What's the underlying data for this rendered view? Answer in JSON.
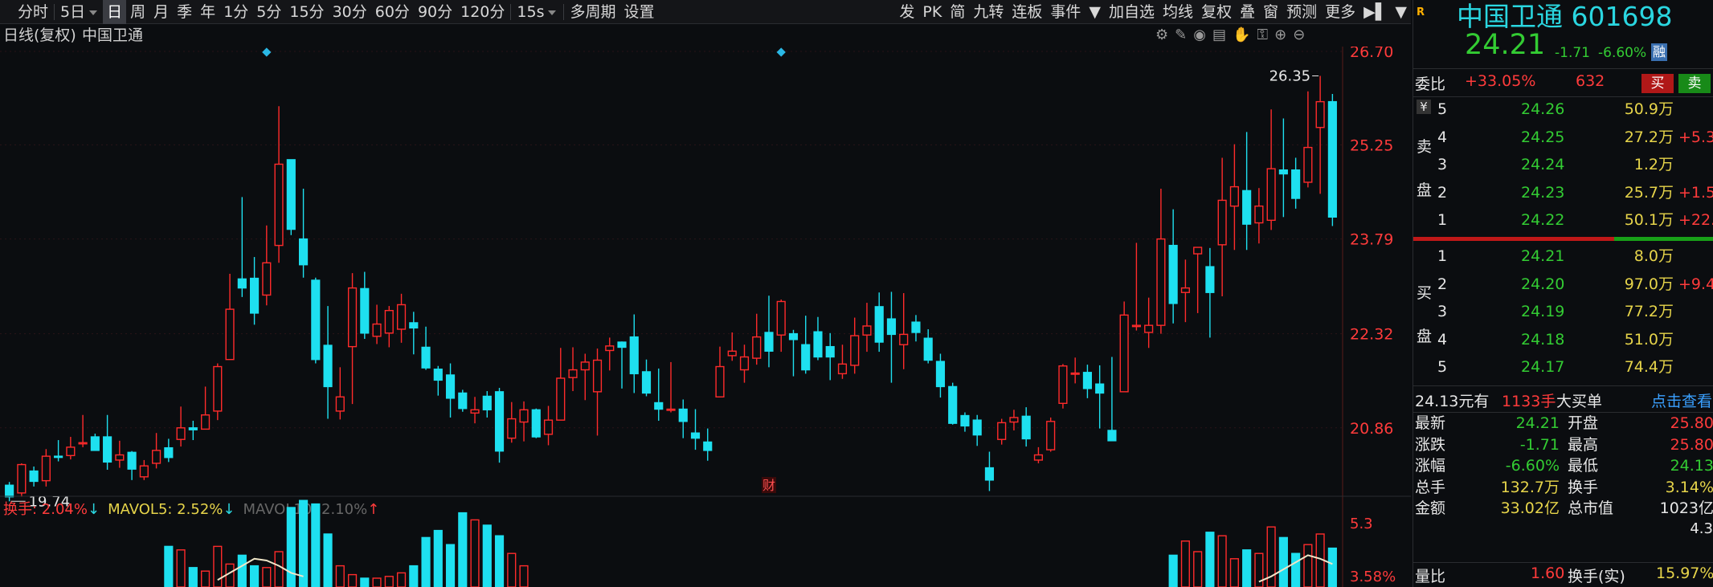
{
  "toolbar": {
    "left": [
      {
        "label": "分时",
        "icon": "back-to-start-icon"
      },
      {
        "label": "5日",
        "dropdown": true
      },
      {
        "label": "日",
        "selected": true
      },
      {
        "label": "周"
      },
      {
        "label": "月"
      },
      {
        "label": "季"
      },
      {
        "label": "年"
      },
      {
        "label": "1分"
      },
      {
        "label": "5分"
      },
      {
        "label": "15分"
      },
      {
        "label": "30分"
      },
      {
        "label": "60分"
      },
      {
        "label": "90分"
      },
      {
        "label": "120分"
      },
      {
        "label": "15s",
        "dropdown": true
      },
      {
        "label": "多周期"
      },
      {
        "label": "设置"
      }
    ],
    "right": [
      {
        "label": "发",
        "flag": true
      },
      {
        "label": "PK"
      },
      {
        "label": "简",
        "flag": true
      },
      {
        "label": "九转"
      },
      {
        "label": "连板",
        "flag": true
      },
      {
        "label": "事件",
        "flag": true
      },
      {
        "label": "▼"
      },
      {
        "label": "加自选"
      },
      {
        "label": "均线"
      },
      {
        "label": "复权"
      },
      {
        "label": "叠"
      },
      {
        "label": "窗"
      },
      {
        "label": "预测"
      },
      {
        "label": "更多"
      },
      {
        "label": "▶▌"
      },
      {
        "label": "▼"
      }
    ]
  },
  "chart_header": {
    "mode": "日线(复权)",
    "name": "中国卫通"
  },
  "colors": {
    "up": "#ff2b2b",
    "down": "#1ee0f0",
    "bg": "#0b0d10",
    "grid": "#2a1418"
  },
  "chart_data": {
    "type": "candlestick",
    "y_ticks": [
      "26.70",
      "25.25",
      "23.79",
      "22.32",
      "20.86"
    ],
    "ylim": [
      19.4,
      26.7
    ],
    "high_label": "26.35",
    "low_label": "19.74",
    "candles": [
      [
        19.97,
        19.79,
        20.02,
        19.72
      ],
      [
        19.85,
        20.29,
        20.31,
        19.79
      ],
      [
        20.19,
        20.03,
        20.26,
        19.95
      ],
      [
        20.04,
        20.42,
        20.53,
        19.95
      ],
      [
        20.42,
        20.41,
        20.67,
        20.34
      ],
      [
        20.43,
        20.56,
        20.72,
        20.37
      ],
      [
        20.63,
        20.63,
        21.06,
        20.56
      ],
      [
        20.72,
        20.51,
        20.77,
        20.51
      ],
      [
        20.72,
        20.33,
        21.06,
        20.21
      ],
      [
        20.36,
        20.44,
        20.66,
        20.24
      ],
      [
        20.48,
        20.22,
        20.5,
        20.05
      ],
      [
        20.1,
        20.27,
        20.36,
        20.05
      ],
      [
        20.31,
        20.51,
        20.78,
        20.23
      ],
      [
        20.55,
        20.4,
        20.69,
        20.33
      ],
      [
        20.68,
        20.86,
        21.19,
        20.57
      ],
      [
        20.86,
        20.83,
        20.97,
        20.67
      ],
      [
        20.84,
        21.06,
        21.5,
        20.84
      ],
      [
        21.12,
        21.81,
        21.86,
        20.98
      ],
      [
        21.92,
        22.7,
        23.25,
        21.92
      ],
      [
        23.17,
        23.03,
        24.44,
        22.89
      ],
      [
        23.18,
        22.64,
        23.51,
        22.46
      ],
      [
        22.92,
        23.42,
        24.0,
        22.76
      ],
      [
        23.69,
        24.95,
        25.85,
        23.42
      ],
      [
        25.02,
        23.94,
        25.02,
        23.85
      ],
      [
        23.79,
        23.39,
        24.57,
        23.19
      ],
      [
        23.15,
        21.92,
        23.19,
        21.86
      ],
      [
        22.14,
        21.5,
        22.75,
        21.0
      ],
      [
        21.12,
        21.34,
        21.8,
        20.99
      ],
      [
        22.12,
        23.03,
        23.26,
        21.23
      ],
      [
        23.02,
        22.33,
        23.28,
        22.24
      ],
      [
        22.28,
        22.47,
        22.77,
        22.16
      ],
      [
        22.33,
        22.68,
        22.75,
        22.11
      ],
      [
        22.39,
        22.77,
        22.94,
        22.18
      ],
      [
        22.49,
        22.41,
        22.66,
        22.0
      ],
      [
        22.11,
        21.79,
        22.43,
        21.76
      ],
      [
        21.77,
        21.6,
        21.82,
        21.36
      ],
      [
        21.68,
        21.32,
        21.86,
        21.02
      ],
      [
        21.4,
        21.16,
        21.45,
        21.11
      ],
      [
        21.09,
        21.14,
        21.34,
        20.93
      ],
      [
        21.35,
        21.14,
        21.43,
        21.02
      ],
      [
        21.42,
        20.5,
        21.48,
        20.32
      ],
      [
        20.7,
        21.0,
        21.26,
        20.63
      ],
      [
        20.95,
        21.14,
        21.27,
        20.65
      ],
      [
        21.14,
        20.72,
        21.16,
        20.7
      ],
      [
        20.76,
        20.98,
        21.2,
        20.59
      ],
      [
        20.98,
        21.63,
        22.1,
        21.13
      ],
      [
        21.64,
        21.76,
        22.11,
        21.43
      ],
      [
        21.76,
        21.88,
        22.01,
        21.29
      ],
      [
        21.42,
        21.91,
        22.09,
        20.74
      ],
      [
        22.06,
        22.13,
        22.26,
        21.75
      ],
      [
        22.19,
        22.11,
        22.2,
        21.47
      ],
      [
        22.27,
        21.7,
        22.62,
        21.4
      ],
      [
        21.73,
        21.4,
        21.92,
        21.35
      ],
      [
        21.25,
        21.15,
        21.78,
        20.97
      ],
      [
        21.15,
        21.15,
        21.88,
        21.1
      ],
      [
        21.15,
        20.96,
        21.3,
        20.7
      ],
      [
        20.78,
        20.7,
        21.15,
        20.52
      ],
      [
        20.64,
        20.51,
        20.85,
        20.35
      ],
      [
        21.34,
        21.81,
        22.12,
        21.38
      ],
      [
        21.98,
        22.05,
        22.34,
        21.9
      ],
      [
        21.76,
        21.96,
        22.15,
        21.56
      ],
      [
        21.94,
        22.27,
        22.63,
        21.84
      ],
      [
        22.34,
        22.05,
        22.91,
        21.8
      ],
      [
        22.3,
        22.82,
        22.85,
        22.04
      ],
      [
        22.32,
        22.23,
        22.38,
        21.66
      ],
      [
        22.15,
        21.76,
        22.6,
        21.7
      ],
      [
        22.35,
        21.96,
        22.58,
        21.91
      ],
      [
        22.12,
        21.96,
        22.33,
        21.6
      ],
      [
        21.7,
        21.85,
        22.15,
        21.62
      ],
      [
        21.83,
        22.29,
        22.57,
        21.7
      ],
      [
        22.3,
        22.44,
        22.8,
        22.04
      ],
      [
        22.74,
        22.19,
        22.96,
        22.04
      ],
      [
        22.55,
        22.31,
        22.97,
        21.56
      ],
      [
        22.15,
        22.31,
        22.95,
        21.77
      ],
      [
        22.5,
        22.34,
        22.61,
        22.2
      ],
      [
        22.25,
        21.91,
        22.39,
        21.86
      ],
      [
        21.89,
        21.5,
        22.01,
        21.33
      ],
      [
        21.5,
        20.93,
        21.56,
        20.91
      ],
      [
        21.05,
        20.89,
        21.1,
        20.8
      ],
      [
        20.98,
        20.75,
        21.06,
        20.58
      ],
      [
        20.24,
        20.05,
        20.49,
        19.88
      ],
      [
        20.68,
        20.94,
        21.0,
        20.6
      ],
      [
        20.95,
        21.02,
        21.14,
        20.82
      ],
      [
        21.04,
        20.69,
        21.18,
        20.57
      ],
      [
        20.36,
        20.44,
        20.56,
        20.31
      ],
      [
        20.52,
        20.96,
        21.02,
        20.49
      ],
      [
        21.24,
        21.82,
        21.85,
        21.16
      ],
      [
        21.71,
        21.71,
        21.95,
        21.55
      ],
      [
        21.72,
        21.47,
        21.84,
        21.32
      ],
      [
        21.54,
        21.4,
        21.83,
        20.85
      ],
      [
        20.82,
        20.66,
        21.96,
        20.66
      ],
      [
        21.42,
        22.61,
        22.82,
        21.42
      ],
      [
        22.45,
        22.45,
        23.73,
        22.37
      ],
      [
        22.34,
        22.45,
        22.88,
        22.1
      ],
      [
        22.45,
        23.79,
        24.57,
        22.32
      ],
      [
        23.69,
        22.79,
        24.25,
        22.48
      ],
      [
        22.96,
        23.03,
        23.47,
        22.5
      ],
      [
        23.56,
        23.66,
        23.61,
        22.64
      ],
      [
        23.36,
        22.96,
        23.65,
        22.26
      ],
      [
        23.7,
        24.39,
        25.05,
        22.9
      ],
      [
        24.3,
        24.6,
        25.26,
        23.62
      ],
      [
        24.54,
        24.02,
        25.45,
        23.62
      ],
      [
        24.04,
        24.3,
        24.58,
        23.72
      ],
      [
        24.08,
        24.88,
        25.8,
        23.93
      ],
      [
        24.86,
        24.8,
        25.66,
        24.13
      ],
      [
        24.86,
        24.42,
        25.05,
        24.26
      ],
      [
        24.67,
        25.21,
        26.08,
        24.59
      ],
      [
        25.52,
        25.92,
        26.32,
        24.49
      ],
      [
        25.92,
        24.13,
        26.04,
        23.99
      ]
    ],
    "volume_ticks": [
      "5.3",
      "3.58%"
    ],
    "turnover": [
      2.3,
      2.1,
      1.1,
      0.9,
      2.3,
      1.3,
      1.8,
      1.2,
      1.1,
      2.0,
      4.5,
      4.9,
      4.7,
      3.0,
      1.2,
      0.7,
      0.5,
      0.5,
      0.6,
      0.8,
      1.2,
      2.8,
      3.2,
      2.4,
      4.2,
      3.8,
      3.5,
      2.9,
      1.9,
      1.2
    ],
    "volume_start_index": 13,
    "volume_tail": [
      1.8,
      2.6,
      2.0,
      3.1,
      2.9,
      1.6,
      2.1,
      1.9,
      3.4,
      2.8,
      1.9,
      2.4,
      3.0,
      2.2
    ],
    "mavol5_line": [
      0.4,
      0.8,
      1.2,
      1.6,
      1.5,
      1.2,
      0.8,
      0.6
    ],
    "mavol_tail_line": [
      0.3,
      0.6,
      1.0,
      1.4,
      1.8,
      1.6,
      1.3
    ]
  },
  "indicator_legend": {
    "turnover": "换手: 2.04%",
    "turnover_arrow": "↓",
    "mavol5": "MAVOL5: 2.52%",
    "mavol5_arrow": "↓",
    "mavol10": "MAVOL10: 2.10%",
    "mavol10_arrow": "↑"
  },
  "finance_marker": "财",
  "right_panel": {
    "badge": "R",
    "name": "中国卫通",
    "code": "601698",
    "price": "24.21",
    "change": "-1.71",
    "pct": "-6.60%",
    "market_tag": "融",
    "weibi_label": "委比",
    "weibi": "+33.05%",
    "weicha": "632",
    "buy_btn": "买",
    "sell_btn": "卖",
    "sell_side_label": [
      "卖",
      "盘"
    ],
    "buy_side_label": [
      "买",
      "盘"
    ],
    "currency_icon": "¥",
    "asks": [
      {
        "lvl": "5",
        "price": "24.26",
        "vol": "50.9万",
        "chg": ""
      },
      {
        "lvl": "4",
        "price": "24.25",
        "vol": "27.2万",
        "chg": "+5.3"
      },
      {
        "lvl": "3",
        "price": "24.24",
        "vol": "1.2万",
        "chg": ""
      },
      {
        "lvl": "2",
        "price": "24.23",
        "vol": "25.7万",
        "chg": "+1.5"
      },
      {
        "lvl": "1",
        "price": "24.22",
        "vol": "50.1万",
        "chg": "+22.3"
      }
    ],
    "bids": [
      {
        "lvl": "1",
        "price": "24.21",
        "vol": "8.0万",
        "chg": ""
      },
      {
        "lvl": "2",
        "price": "24.20",
        "vol": "97.0万",
        "chg": "+9.4"
      },
      {
        "lvl": "3",
        "price": "24.19",
        "vol": "77.2万",
        "chg": ""
      },
      {
        "lvl": "4",
        "price": "24.18",
        "vol": "51.0万",
        "chg": ""
      },
      {
        "lvl": "5",
        "price": "24.17",
        "vol": "74.4万",
        "chg": ""
      }
    ],
    "big_order": {
      "text1": "24.13元有",
      "text2": "1133手",
      "text3": "大买单",
      "link": "点击查看"
    },
    "stats": [
      {
        "l1": "最新",
        "v1": "24.21",
        "c1": "green",
        "l2": "开盘",
        "v2": "25.80",
        "c2": "red"
      },
      {
        "l1": "涨跌",
        "v1": "-1.71",
        "c1": "green",
        "l2": "最高",
        "v2": "25.80",
        "c2": "red"
      },
      {
        "l1": "涨幅",
        "v1": "-6.60%",
        "c1": "green",
        "l2": "最低",
        "v2": "24.13",
        "c2": "green"
      },
      {
        "l1": "总手",
        "v1": "132.7万",
        "c1": "yellow",
        "l2": "换手",
        "v2": "3.14%",
        "c2": "yellow"
      },
      {
        "l1": "金额",
        "v1": "33.02亿",
        "c1": "yellow",
        "l2": "总市值",
        "v2": "1023亿",
        "c2": "white"
      }
    ],
    "liangbi": {
      "l1": "量比",
      "v1": "1.60",
      "l2": "换手(实)",
      "v2": "15.97%"
    },
    "overflow": [
      "4.3",
      "%"
    ]
  }
}
